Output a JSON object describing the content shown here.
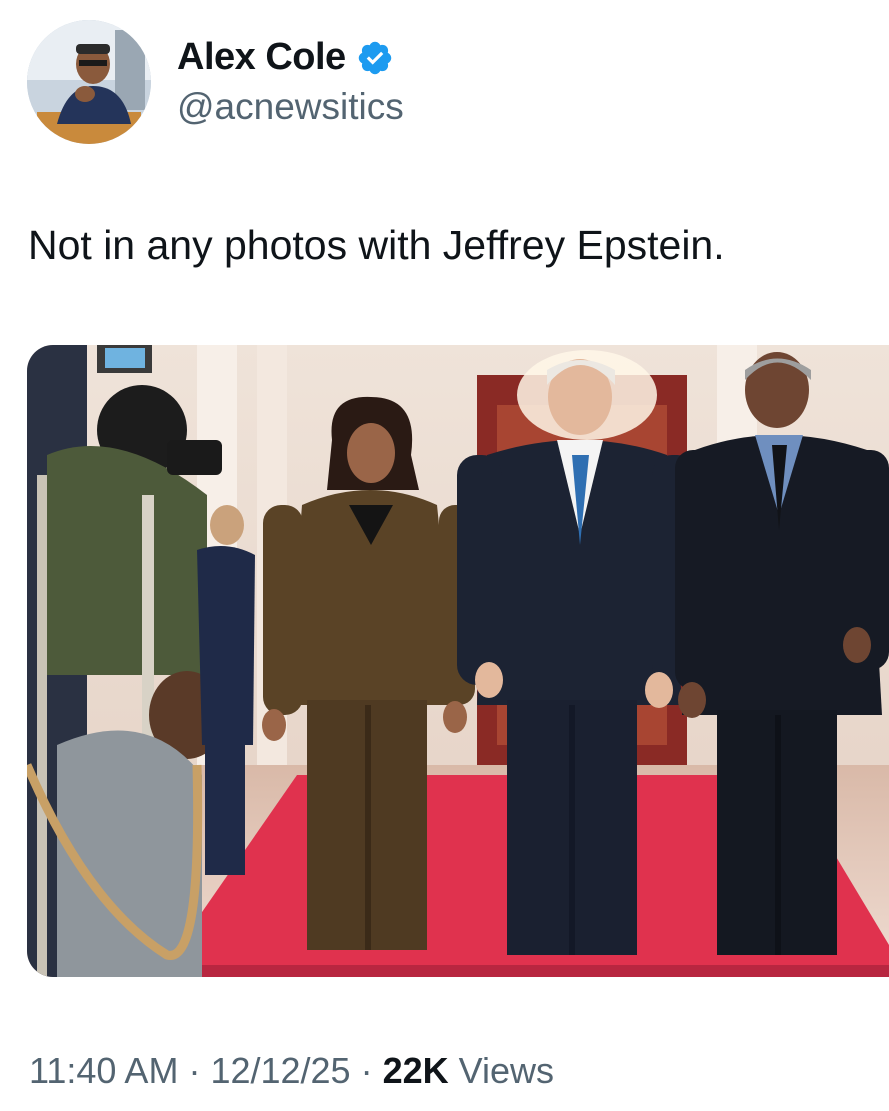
{
  "author": {
    "display_name": "Alex Cole",
    "handle": "@acnewsitics",
    "verified": true,
    "avatar_icon": "profile-photo"
  },
  "tweet": {
    "text": "Not in any photos with Jeffrey Epstein.",
    "media": {
      "description_icon": "photo"
    }
  },
  "meta": {
    "time": "11:40 AM",
    "separator": "·",
    "date": "12/12/25",
    "views_count": "22K",
    "views_label": "Views"
  },
  "colors": {
    "text_primary": "#0f1419",
    "text_secondary": "#536471",
    "verified_blue": "#1d9bf0",
    "carpet_red": "#e0324e"
  }
}
